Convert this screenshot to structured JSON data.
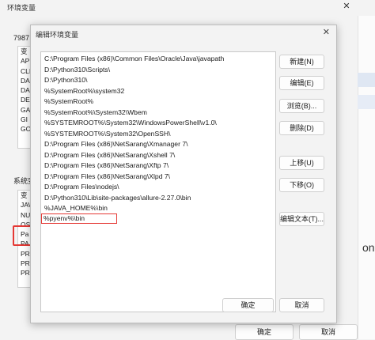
{
  "bg_window": {
    "title": "环境变量",
    "close_glyph": "✕",
    "user_section_label": "7987",
    "user_rows": [
      "变",
      "AP",
      "CLI",
      "DA",
      "DA",
      "DE",
      "GA",
      "GI",
      "GO"
    ],
    "system_section_label": "系统变",
    "system_rows": [
      "变",
      "JAV",
      "NU",
      "OS",
      "Pa",
      "PA",
      "PR",
      "PR",
      "PR"
    ],
    "right_edge_text": "on",
    "ok_label": "确定",
    "cancel_label": "取消"
  },
  "dialog": {
    "title": "编辑环境变量",
    "close_glyph": "✕",
    "paths": [
      "C:\\Program Files (x86)\\Common Files\\Oracle\\Java\\javapath",
      "D:\\Python310\\Scripts\\",
      "D:\\Python310\\",
      "%SystemRoot%\\system32",
      "%SystemRoot%",
      "%SystemRoot%\\System32\\Wbem",
      "%SYSTEMROOT%\\System32\\WindowsPowerShell\\v1.0\\",
      "%SYSTEMROOT%\\System32\\OpenSSH\\",
      "D:\\Program Files (x86)\\NetSarang\\Xmanager 7\\",
      "D:\\Program Files (x86)\\NetSarang\\Xshell 7\\",
      "D:\\Program Files (x86)\\NetSarang\\Xftp 7\\",
      "D:\\Program Files (x86)\\NetSarang\\Xlpd 7\\",
      "D:\\Program Files\\nodejs\\",
      "D:\\Python310\\Lib\\site-packages\\allure-2.27.0\\bin",
      "%JAVA_HOME%\\bin",
      "%pyenv%\\bin"
    ],
    "buttons": {
      "new": "新建(N)",
      "edit": "编辑(E)",
      "browse": "浏览(B)...",
      "delete": "删除(D)",
      "move_up": "上移(U)",
      "move_down": "下移(O)",
      "edit_text": "编辑文本(T)...",
      "ok": "确定",
      "cancel": "取消"
    }
  }
}
